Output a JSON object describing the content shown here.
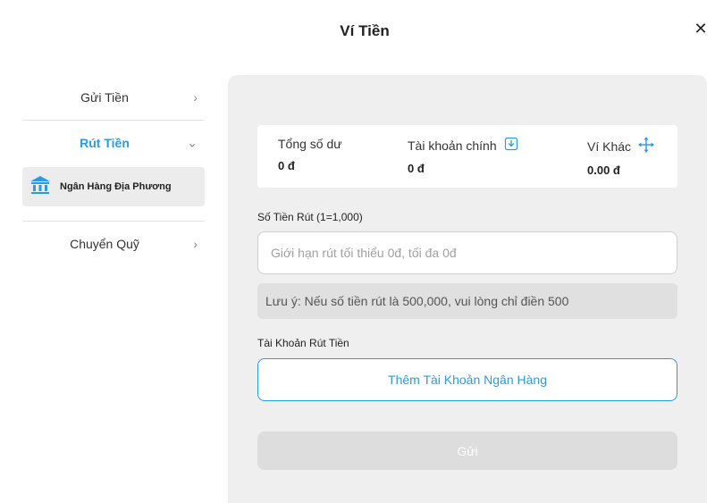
{
  "modal": {
    "title": "Ví Tiền",
    "close_icon": "close-icon"
  },
  "sidebar": {
    "items": [
      {
        "label": "Gửi Tiền",
        "icon": "chevron-right-icon",
        "active": false
      },
      {
        "label": "Rút Tiền",
        "icon": "chevron-down-icon",
        "active": true
      },
      {
        "label": "Chuyển Quỹ",
        "icon": "chevron-right-icon",
        "active": false
      }
    ],
    "sub_items": [
      {
        "label": "Ngân Hàng Địa Phương",
        "icon": "bank-icon"
      }
    ]
  },
  "balance": {
    "total_label": "Tổng số dư",
    "total_value": "0 đ",
    "main_label": "Tài khoản chính",
    "main_value": "0 đ",
    "main_icon": "download-icon",
    "other_label": "Ví Khác",
    "other_value": "0.00 đ",
    "other_icon": "move-arrows-icon"
  },
  "withdraw": {
    "amount_label": "Số Tiền Rút (1=1,000)",
    "amount_placeholder": "Giới hạn rút tối thiểu 0đ, tối đa 0đ",
    "note": "Lưu ý: Nếu số tiền rút là 500,000, vui lòng chỉ điền 500",
    "account_label": "Tài Khoản Rút Tiền",
    "add_bank_label": "Thêm Tài Khoản Ngân Hàng",
    "submit_label": "Gửi"
  },
  "colors": {
    "accent": "#2a9be0",
    "panel_bg": "#efefef",
    "top_strip": "#2a5c8c"
  }
}
